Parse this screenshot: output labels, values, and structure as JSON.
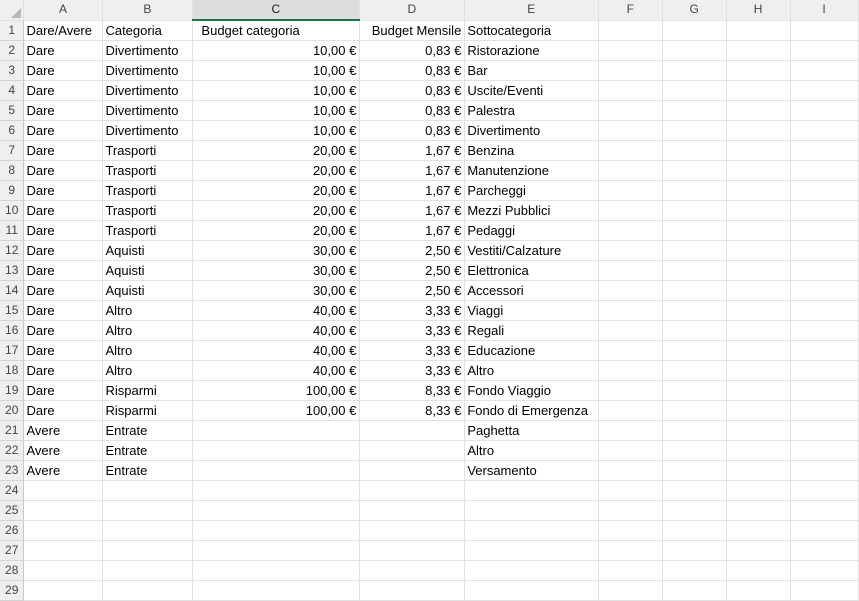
{
  "columns": [
    "A",
    "B",
    "C",
    "D",
    "E",
    "F",
    "G",
    "H",
    "I"
  ],
  "selected_column": "C",
  "rows": [
    {
      "n": "1",
      "a": "Dare/Avere",
      "b": "Categoria",
      "c": "Budget categoria",
      "d": "Budget Mensile",
      "e": "Sottocategoria",
      "c_align": "center",
      "d_align": "right"
    },
    {
      "n": "2",
      "a": "Dare",
      "b": "Divertimento",
      "c": "10,00 €",
      "d": "0,83 €",
      "e": "Ristorazione"
    },
    {
      "n": "3",
      "a": "Dare",
      "b": "Divertimento",
      "c": "10,00 €",
      "d": "0,83 €",
      "e": "Bar"
    },
    {
      "n": "4",
      "a": "Dare",
      "b": "Divertimento",
      "c": "10,00 €",
      "d": "0,83 €",
      "e": "Uscite/Eventi"
    },
    {
      "n": "5",
      "a": "Dare",
      "b": "Divertimento",
      "c": "10,00 €",
      "d": "0,83 €",
      "e": "Palestra"
    },
    {
      "n": "6",
      "a": "Dare",
      "b": "Divertimento",
      "c": "10,00 €",
      "d": "0,83 €",
      "e": "Divertimento"
    },
    {
      "n": "7",
      "a": "Dare",
      "b": "Trasporti",
      "c": "20,00 €",
      "d": "1,67 €",
      "e": "Benzina"
    },
    {
      "n": "8",
      "a": "Dare",
      "b": "Trasporti",
      "c": "20,00 €",
      "d": "1,67 €",
      "e": "Manutenzione"
    },
    {
      "n": "9",
      "a": "Dare",
      "b": "Trasporti",
      "c": "20,00 €",
      "d": "1,67 €",
      "e": "Parcheggi"
    },
    {
      "n": "10",
      "a": "Dare",
      "b": "Trasporti",
      "c": "20,00 €",
      "d": "1,67 €",
      "e": "Mezzi Pubblici"
    },
    {
      "n": "11",
      "a": "Dare",
      "b": "Trasporti",
      "c": "20,00 €",
      "d": "1,67 €",
      "e": "Pedaggi"
    },
    {
      "n": "12",
      "a": "Dare",
      "b": "Aquisti",
      "c": "30,00 €",
      "d": "2,50 €",
      "e": "Vestiti/Calzature"
    },
    {
      "n": "13",
      "a": "Dare",
      "b": "Aquisti",
      "c": "30,00 €",
      "d": "2,50 €",
      "e": "Elettronica"
    },
    {
      "n": "14",
      "a": "Dare",
      "b": "Aquisti",
      "c": "30,00 €",
      "d": "2,50 €",
      "e": "Accessori"
    },
    {
      "n": "15",
      "a": "Dare",
      "b": "Altro",
      "c": "40,00 €",
      "d": "3,33 €",
      "e": "Viaggi"
    },
    {
      "n": "16",
      "a": "Dare",
      "b": "Altro",
      "c": "40,00 €",
      "d": "3,33 €",
      "e": "Regali"
    },
    {
      "n": "17",
      "a": "Dare",
      "b": "Altro",
      "c": "40,00 €",
      "d": "3,33 €",
      "e": "Educazione"
    },
    {
      "n": "18",
      "a": "Dare",
      "b": "Altro",
      "c": "40,00 €",
      "d": "3,33 €",
      "e": "Altro"
    },
    {
      "n": "19",
      "a": "Dare",
      "b": "Risparmi",
      "c": "100,00 €",
      "d": "8,33 €",
      "e": "Fondo Viaggio"
    },
    {
      "n": "20",
      "a": "Dare",
      "b": "Risparmi",
      "c": "100,00 €",
      "d": "8,33 €",
      "e": "Fondo di Emergenza"
    },
    {
      "n": "21",
      "a": "Avere",
      "b": "Entrate",
      "c": "",
      "d": "",
      "e": "Paghetta"
    },
    {
      "n": "22",
      "a": "Avere",
      "b": "Entrate",
      "c": "",
      "d": "",
      "e": "Altro"
    },
    {
      "n": "23",
      "a": "Avere",
      "b": "Entrate",
      "c": "",
      "d": "",
      "e": "Versamento"
    },
    {
      "n": "24",
      "a": "",
      "b": "",
      "c": "",
      "d": "",
      "e": ""
    },
    {
      "n": "25",
      "a": "",
      "b": "",
      "c": "",
      "d": "",
      "e": ""
    },
    {
      "n": "26",
      "a": "",
      "b": "",
      "c": "",
      "d": "",
      "e": ""
    },
    {
      "n": "27",
      "a": "",
      "b": "",
      "c": "",
      "d": "",
      "e": ""
    },
    {
      "n": "28",
      "a": "",
      "b": "",
      "c": "",
      "d": "",
      "e": ""
    },
    {
      "n": "29",
      "a": "",
      "b": "",
      "c": "",
      "d": "",
      "e": ""
    }
  ]
}
